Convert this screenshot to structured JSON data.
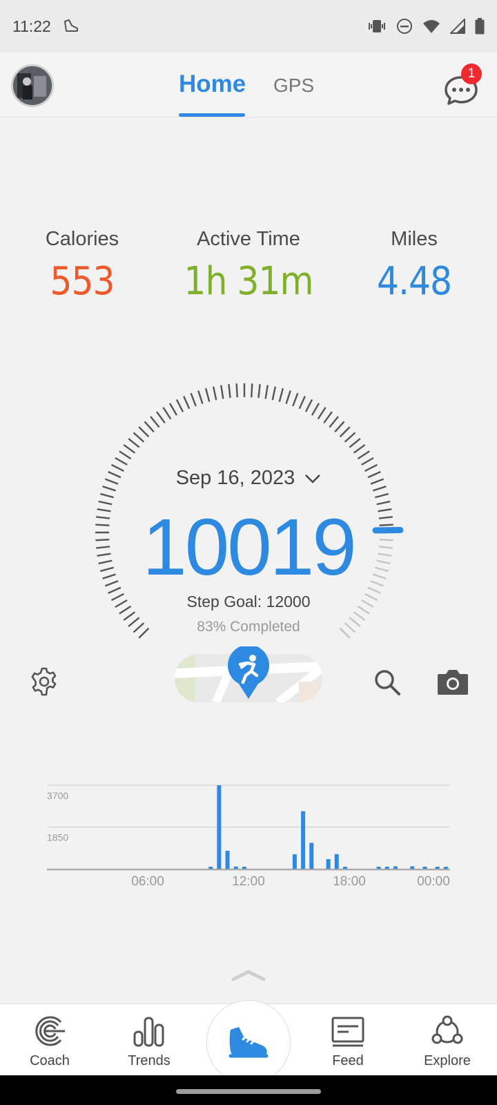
{
  "status_bar": {
    "time": "11:22",
    "icons": [
      "shoe-notification-icon",
      "vibrate-icon",
      "do-not-disturb-icon",
      "wifi-icon",
      "cell-signal-icon",
      "battery-icon"
    ]
  },
  "header": {
    "tabs": [
      {
        "label": "Home",
        "active": true
      },
      {
        "label": "GPS",
        "active": false
      }
    ],
    "messages_badge": "1",
    "accent_color": "#2e8ae0"
  },
  "stats": [
    {
      "label": "Calories",
      "value": "553",
      "color": "#ef5a2c"
    },
    {
      "label": "Active Time",
      "value": "1h 31m",
      "color": "#7fb02a"
    },
    {
      "label": "Miles",
      "value": "4.48",
      "color": "#2e8ae0"
    }
  ],
  "steps_panel": {
    "date": "Sep 16, 2023",
    "steps": "10019",
    "goal_text": "Step Goal: 12000",
    "completed_text": "83% Completed",
    "progress_fraction": 0.83
  },
  "chart_data": {
    "type": "bar",
    "x_tick_labels": [
      "06:00",
      "12:00",
      "18:00",
      "00:00"
    ],
    "y_tick_labels": [
      "3700",
      "1850"
    ],
    "ylim": [
      0,
      3700
    ],
    "x_range_hours": [
      0,
      24
    ],
    "bar_color": "#2e8ae0",
    "bars": [
      {
        "hour": 9.75,
        "value": 80
      },
      {
        "hour": 10.25,
        "value": 3700
      },
      {
        "hour": 10.75,
        "value": 800
      },
      {
        "hour": 11.25,
        "value": 100
      },
      {
        "hour": 11.75,
        "value": 60
      },
      {
        "hour": 14.75,
        "value": 640
      },
      {
        "hour": 15.25,
        "value": 2550
      },
      {
        "hour": 15.75,
        "value": 1150
      },
      {
        "hour": 16.75,
        "value": 430
      },
      {
        "hour": 17.25,
        "value": 650
      },
      {
        "hour": 17.75,
        "value": 60
      },
      {
        "hour": 19.75,
        "value": 90
      },
      {
        "hour": 20.25,
        "value": 90
      },
      {
        "hour": 20.75,
        "value": 110
      },
      {
        "hour": 21.75,
        "value": 110
      },
      {
        "hour": 22.5,
        "value": 60
      },
      {
        "hour": 23.25,
        "value": 60
      },
      {
        "hour": 23.75,
        "value": 50
      }
    ]
  },
  "bottom_nav": {
    "items": [
      {
        "label": "Coach",
        "icon": "coach-icon"
      },
      {
        "label": "Trends",
        "icon": "trends-icon"
      },
      {
        "label": "",
        "icon": "shoe-icon"
      },
      {
        "label": "Feed",
        "icon": "feed-icon"
      },
      {
        "label": "Explore",
        "icon": "explore-icon"
      }
    ]
  }
}
